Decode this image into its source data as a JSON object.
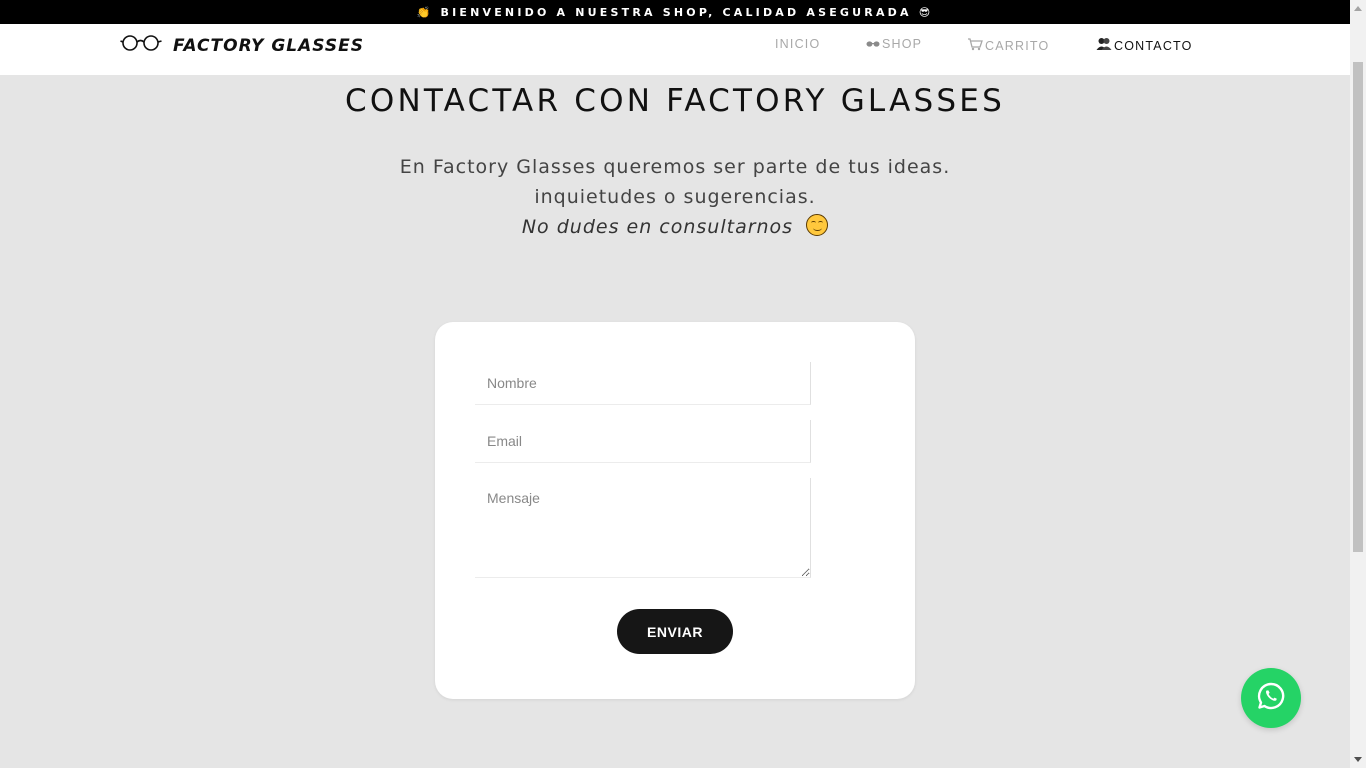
{
  "announcement": {
    "text": "👏 BIENVENIDO A NUESTRA SHOP, CALIDAD ASEGURADA 😎"
  },
  "navbar": {
    "brand": {
      "icon": "glasses-icon",
      "name": "FACTORY GLASSES"
    },
    "links": [
      {
        "label": "INICIO",
        "active": false
      },
      {
        "label": "SHOP",
        "icon": "glasses-icon",
        "active": false
      },
      {
        "label": "CARRITO",
        "icon": "cart-icon",
        "active": false
      },
      {
        "label": "CONTACTO",
        "icon": "contact-icon",
        "active": true
      }
    ]
  },
  "page": {
    "title": "CONTACTAR CON FACTORY GLASSES",
    "intro_line1": "En Factory Glasses queremos ser parte de tus ideas.",
    "intro_line2": "inquietudes o sugerencias.",
    "intro_line3": "No dudes en consultarnos",
    "intro_emoji": "smiling-face-icon"
  },
  "form": {
    "name_placeholder": "Nombre",
    "email_placeholder": "Email",
    "message_placeholder": "Mensaje",
    "submit_label": "ENVIAR"
  },
  "floating": {
    "whatsapp_icon": "whatsapp-icon"
  },
  "colors": {
    "page_background": "#e5e5e5",
    "announcement_background": "#000000",
    "active_link": "#111111",
    "inactive_link": "#a8a8a8",
    "button": "#161616",
    "whatsapp": "#25d366"
  }
}
